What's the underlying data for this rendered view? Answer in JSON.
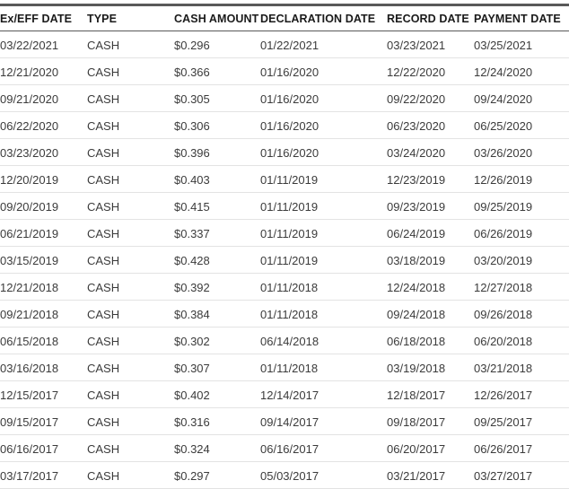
{
  "table": {
    "columns": [
      {
        "key": "ex_eff_date",
        "label": "Ex/EFF DATE",
        "name": "column-ex-eff-date"
      },
      {
        "key": "type",
        "label": "TYPE",
        "name": "column-type"
      },
      {
        "key": "cash_amount",
        "label": "CASH AMOUNT",
        "name": "column-cash-amount"
      },
      {
        "key": "declaration_date",
        "label": "DECLARATION DATE",
        "name": "column-declaration-date"
      },
      {
        "key": "record_date",
        "label": "RECORD DATE",
        "name": "column-record-date"
      },
      {
        "key": "payment_date",
        "label": "PAYMENT DATE",
        "name": "column-payment-date"
      }
    ],
    "rows": [
      {
        "ex_eff_date": "03/22/2021",
        "type": "CASH",
        "cash_amount": "$0.296",
        "declaration_date": "01/22/2021",
        "record_date": "03/23/2021",
        "payment_date": "03/25/2021"
      },
      {
        "ex_eff_date": "12/21/2020",
        "type": "CASH",
        "cash_amount": "$0.366",
        "declaration_date": "01/16/2020",
        "record_date": "12/22/2020",
        "payment_date": "12/24/2020"
      },
      {
        "ex_eff_date": "09/21/2020",
        "type": "CASH",
        "cash_amount": "$0.305",
        "declaration_date": "01/16/2020",
        "record_date": "09/22/2020",
        "payment_date": "09/24/2020"
      },
      {
        "ex_eff_date": "06/22/2020",
        "type": "CASH",
        "cash_amount": "$0.306",
        "declaration_date": "01/16/2020",
        "record_date": "06/23/2020",
        "payment_date": "06/25/2020"
      },
      {
        "ex_eff_date": "03/23/2020",
        "type": "CASH",
        "cash_amount": "$0.396",
        "declaration_date": "01/16/2020",
        "record_date": "03/24/2020",
        "payment_date": "03/26/2020"
      },
      {
        "ex_eff_date": "12/20/2019",
        "type": "CASH",
        "cash_amount": "$0.403",
        "declaration_date": "01/11/2019",
        "record_date": "12/23/2019",
        "payment_date": "12/26/2019"
      },
      {
        "ex_eff_date": "09/20/2019",
        "type": "CASH",
        "cash_amount": "$0.415",
        "declaration_date": "01/11/2019",
        "record_date": "09/23/2019",
        "payment_date": "09/25/2019"
      },
      {
        "ex_eff_date": "06/21/2019",
        "type": "CASH",
        "cash_amount": "$0.337",
        "declaration_date": "01/11/2019",
        "record_date": "06/24/2019",
        "payment_date": "06/26/2019"
      },
      {
        "ex_eff_date": "03/15/2019",
        "type": "CASH",
        "cash_amount": "$0.428",
        "declaration_date": "01/11/2019",
        "record_date": "03/18/2019",
        "payment_date": "03/20/2019"
      },
      {
        "ex_eff_date": "12/21/2018",
        "type": "CASH",
        "cash_amount": "$0.392",
        "declaration_date": "01/11/2018",
        "record_date": "12/24/2018",
        "payment_date": "12/27/2018"
      },
      {
        "ex_eff_date": "09/21/2018",
        "type": "CASH",
        "cash_amount": "$0.384",
        "declaration_date": "01/11/2018",
        "record_date": "09/24/2018",
        "payment_date": "09/26/2018"
      },
      {
        "ex_eff_date": "06/15/2018",
        "type": "CASH",
        "cash_amount": "$0.302",
        "declaration_date": "06/14/2018",
        "record_date": "06/18/2018",
        "payment_date": "06/20/2018"
      },
      {
        "ex_eff_date": "03/16/2018",
        "type": "CASH",
        "cash_amount": "$0.307",
        "declaration_date": "01/11/2018",
        "record_date": "03/19/2018",
        "payment_date": "03/21/2018"
      },
      {
        "ex_eff_date": "12/15/2017",
        "type": "CASH",
        "cash_amount": "$0.402",
        "declaration_date": "12/14/2017",
        "record_date": "12/18/2017",
        "payment_date": "12/26/2017"
      },
      {
        "ex_eff_date": "09/15/2017",
        "type": "CASH",
        "cash_amount": "$0.316",
        "declaration_date": "09/14/2017",
        "record_date": "09/18/2017",
        "payment_date": "09/25/2017"
      },
      {
        "ex_eff_date": "06/16/2017",
        "type": "CASH",
        "cash_amount": "$0.324",
        "declaration_date": "06/16/2017",
        "record_date": "06/20/2017",
        "payment_date": "06/26/2017"
      },
      {
        "ex_eff_date": "03/17/2017",
        "type": "CASH",
        "cash_amount": "$0.297",
        "declaration_date": "05/03/2017",
        "record_date": "03/21/2017",
        "payment_date": "03/27/2017"
      }
    ]
  },
  "colors": {
    "header_text": "#1a1a1a",
    "body_text": "#3b3b3b",
    "header_rule": "#595959",
    "row_rule": "#e3e3e3",
    "background": "#ffffff"
  }
}
